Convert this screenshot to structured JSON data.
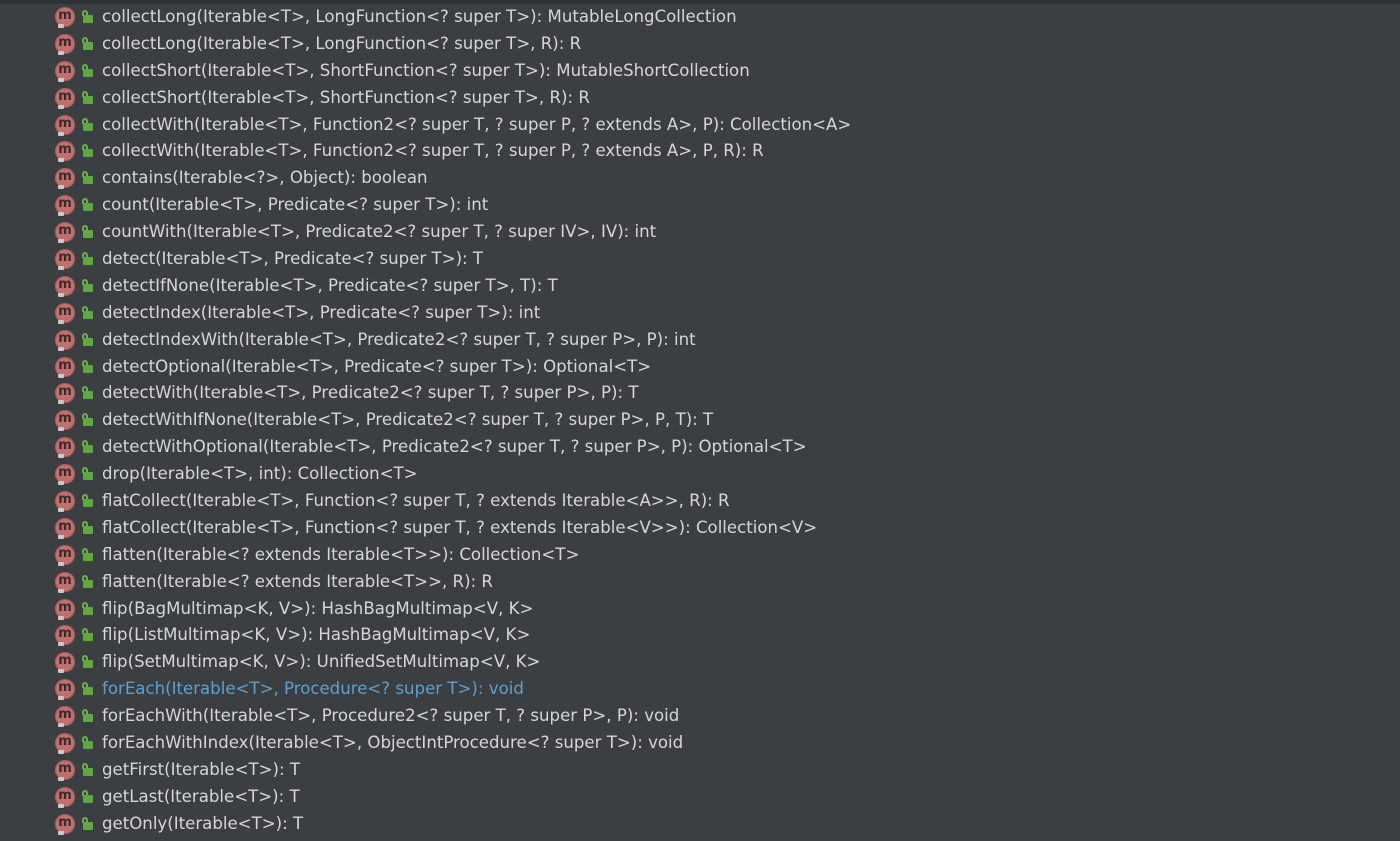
{
  "methods": {
    "items": [
      {
        "label": "collectLong(Iterable<T>, LongFunction<? super T>): MutableLongCollection"
      },
      {
        "label": "collectLong(Iterable<T>, LongFunction<? super T>, R): R"
      },
      {
        "label": "collectShort(Iterable<T>, ShortFunction<? super T>): MutableShortCollection"
      },
      {
        "label": "collectShort(Iterable<T>, ShortFunction<? super T>, R): R"
      },
      {
        "label": "collectWith(Iterable<T>, Function2<? super T, ? super P, ? extends A>, P): Collection<A>"
      },
      {
        "label": "collectWith(Iterable<T>, Function2<? super T, ? super P, ? extends A>, P, R): R"
      },
      {
        "label": "contains(Iterable<?>, Object): boolean"
      },
      {
        "label": "count(Iterable<T>, Predicate<? super T>): int"
      },
      {
        "label": "countWith(Iterable<T>, Predicate2<? super T, ? super IV>, IV): int"
      },
      {
        "label": "detect(Iterable<T>, Predicate<? super T>): T"
      },
      {
        "label": "detectIfNone(Iterable<T>, Predicate<? super T>, T): T"
      },
      {
        "label": "detectIndex(Iterable<T>, Predicate<? super T>): int"
      },
      {
        "label": "detectIndexWith(Iterable<T>, Predicate2<? super T, ? super P>, P): int"
      },
      {
        "label": "detectOptional(Iterable<T>, Predicate<? super T>): Optional<T>"
      },
      {
        "label": "detectWith(Iterable<T>, Predicate2<? super T, ? super P>, P): T"
      },
      {
        "label": "detectWithIfNone(Iterable<T>, Predicate2<? super T, ? super P>, P, T): T"
      },
      {
        "label": "detectWithOptional(Iterable<T>, Predicate2<? super T, ? super P>, P): Optional<T>"
      },
      {
        "label": "drop(Iterable<T>, int): Collection<T>"
      },
      {
        "label": "flatCollect(Iterable<T>, Function<? super T, ? extends Iterable<A>>, R): R"
      },
      {
        "label": "flatCollect(Iterable<T>, Function<? super T, ? extends Iterable<V>>): Collection<V>"
      },
      {
        "label": "flatten(Iterable<? extends Iterable<T>>): Collection<T>"
      },
      {
        "label": "flatten(Iterable<? extends Iterable<T>>, R): R"
      },
      {
        "label": "flip(BagMultimap<K, V>): HashBagMultimap<V, K>"
      },
      {
        "label": "flip(ListMultimap<K, V>): HashBagMultimap<V, K>"
      },
      {
        "label": "flip(SetMultimap<K, V>): UnifiedSetMultimap<V, K>"
      },
      {
        "label": "forEach(Iterable<T>, Procedure<? super T>): void"
      },
      {
        "label": "forEachWith(Iterable<T>, Procedure2<? super T, ? super P>, P): void"
      },
      {
        "label": "forEachWithIndex(Iterable<T>, ObjectIntProcedure<? super T>): void"
      },
      {
        "label": "getFirst(Iterable<T>): T"
      },
      {
        "label": "getLast(Iterable<T>): T"
      },
      {
        "label": "getOnly(Iterable<T>): T"
      }
    ],
    "selected_index": 25
  },
  "colors": {
    "background": "#3c3f41",
    "text": "#d6d6d6",
    "selected_text": "#5f9fd0",
    "method_icon": "#c0716f",
    "public_icon": "#5fa843"
  },
  "icons": {
    "method": "method-icon",
    "visibility": "public-lock-icon"
  }
}
